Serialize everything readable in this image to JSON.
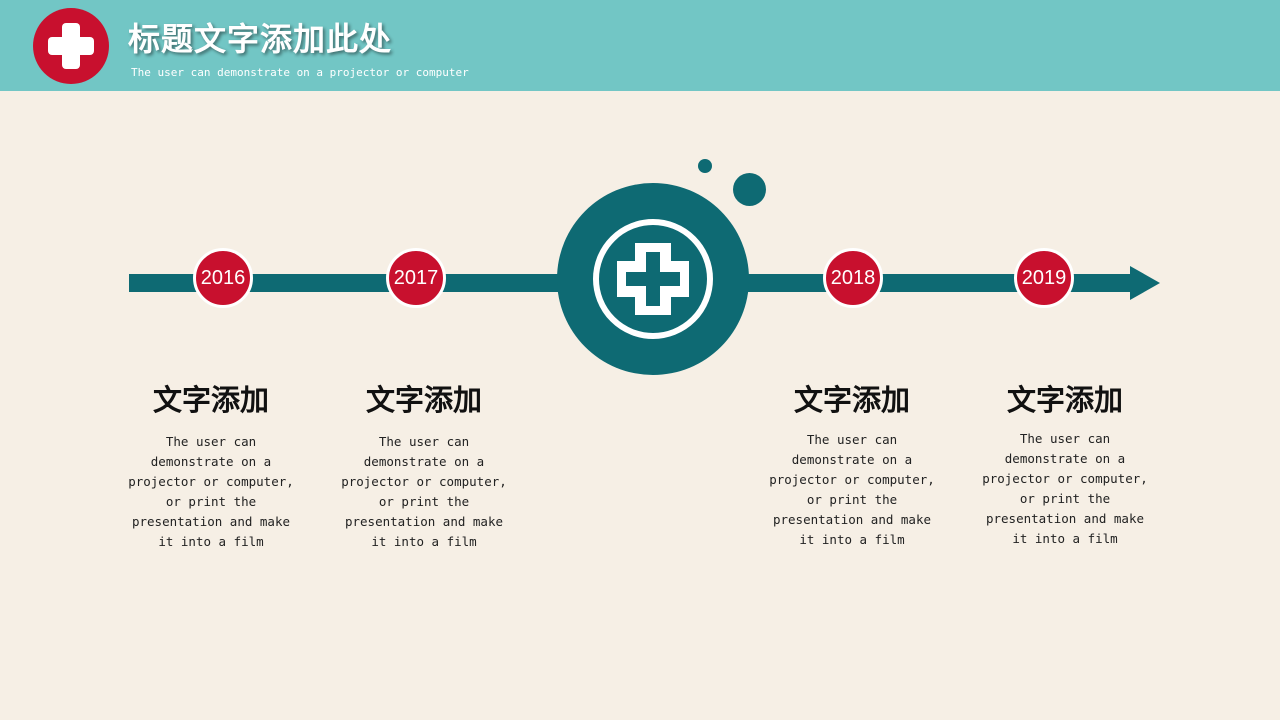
{
  "header": {
    "title": "标题文字添加此处",
    "subtitle": "The user can demonstrate on a projector or computer",
    "logo_icon": "plus-cross-icon"
  },
  "colors": {
    "header_bg": "#72c6c5",
    "background": "#f6efe5",
    "accent_red": "#c8102e",
    "teal": "#0e6a73"
  },
  "timeline": {
    "center_icon": "medical-cross-icon",
    "milestones": [
      {
        "year": "2016",
        "heading": "文字添加",
        "text": "The user can\ndemonstrate on a\nprojector or computer,\nor print the\npresentation and make\nit into a film"
      },
      {
        "year": "2017",
        "heading": "文字添加",
        "text": "The user can\ndemonstrate on a\nprojector or computer,\nor print the\npresentation and make\nit into a film"
      },
      {
        "year": "2018",
        "heading": "文字添加",
        "text": "The user can\ndemonstrate on a\nprojector or computer,\nor print the\npresentation and make\nit into a film"
      },
      {
        "year": "2019",
        "heading": "文字添加",
        "text": "The user can\ndemonstrate on a\nprojector or computer,\nor print the\npresentation and make\nit into a film"
      }
    ]
  }
}
